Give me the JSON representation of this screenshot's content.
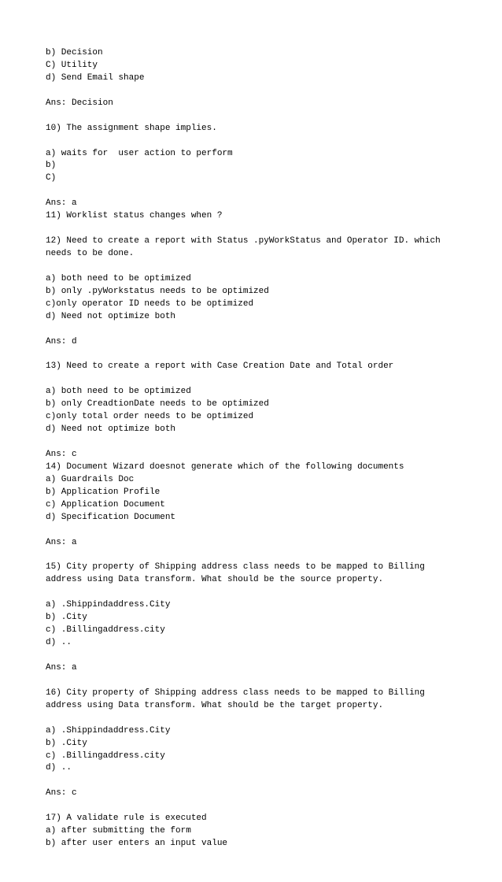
{
  "lines": [
    "b) Decision",
    "C) Utility",
    "d) Send Email shape",
    "",
    "Ans: Decision",
    "",
    "10) The assignment shape implies.",
    "",
    "a) waits for  user action to perform",
    "b)",
    "C)",
    "",
    "Ans: a",
    "11) Worklist status changes when ?",
    "",
    "12) Need to create a report with Status .pyWorkStatus and Operator ID. which needs to be done.",
    "",
    "a) both need to be optimized",
    "b) only .pyWorkstatus needs to be optimized",
    "c)only operator ID needs to be optimized",
    "d) Need not optimize both",
    "",
    "Ans: d",
    "",
    "13) Need to create a report with Case Creation Date and Total order",
    "",
    "a) both need to be optimized",
    "b) only CreadtionDate needs to be optimized",
    "c)only total order needs to be optimized",
    "d) Need not optimize both",
    "",
    "Ans: c",
    "14) Document Wizard doesnot generate which of the following documents",
    "a) Guardrails Doc",
    "b) Application Profile",
    "c) Application Document",
    "d) Specification Document",
    "",
    "Ans: a",
    "",
    "15) City property of Shipping address class needs to be mapped to Billing address using Data transform. What should be the source property.",
    "",
    "a) .Shippindaddress.City",
    "b) .City",
    "c) .Billingaddress.city",
    "d) ..",
    "",
    "Ans: a",
    "",
    "16) City property of Shipping address class needs to be mapped to Billing address using Data transform. What should be the target property.",
    "",
    "a) .Shippindaddress.City",
    "b) .City",
    "c) .Billingaddress.city",
    "d) ..",
    "",
    "Ans: c",
    "",
    "17) A validate rule is executed",
    "a) after submitting the form",
    "b) after user enters an input value"
  ]
}
